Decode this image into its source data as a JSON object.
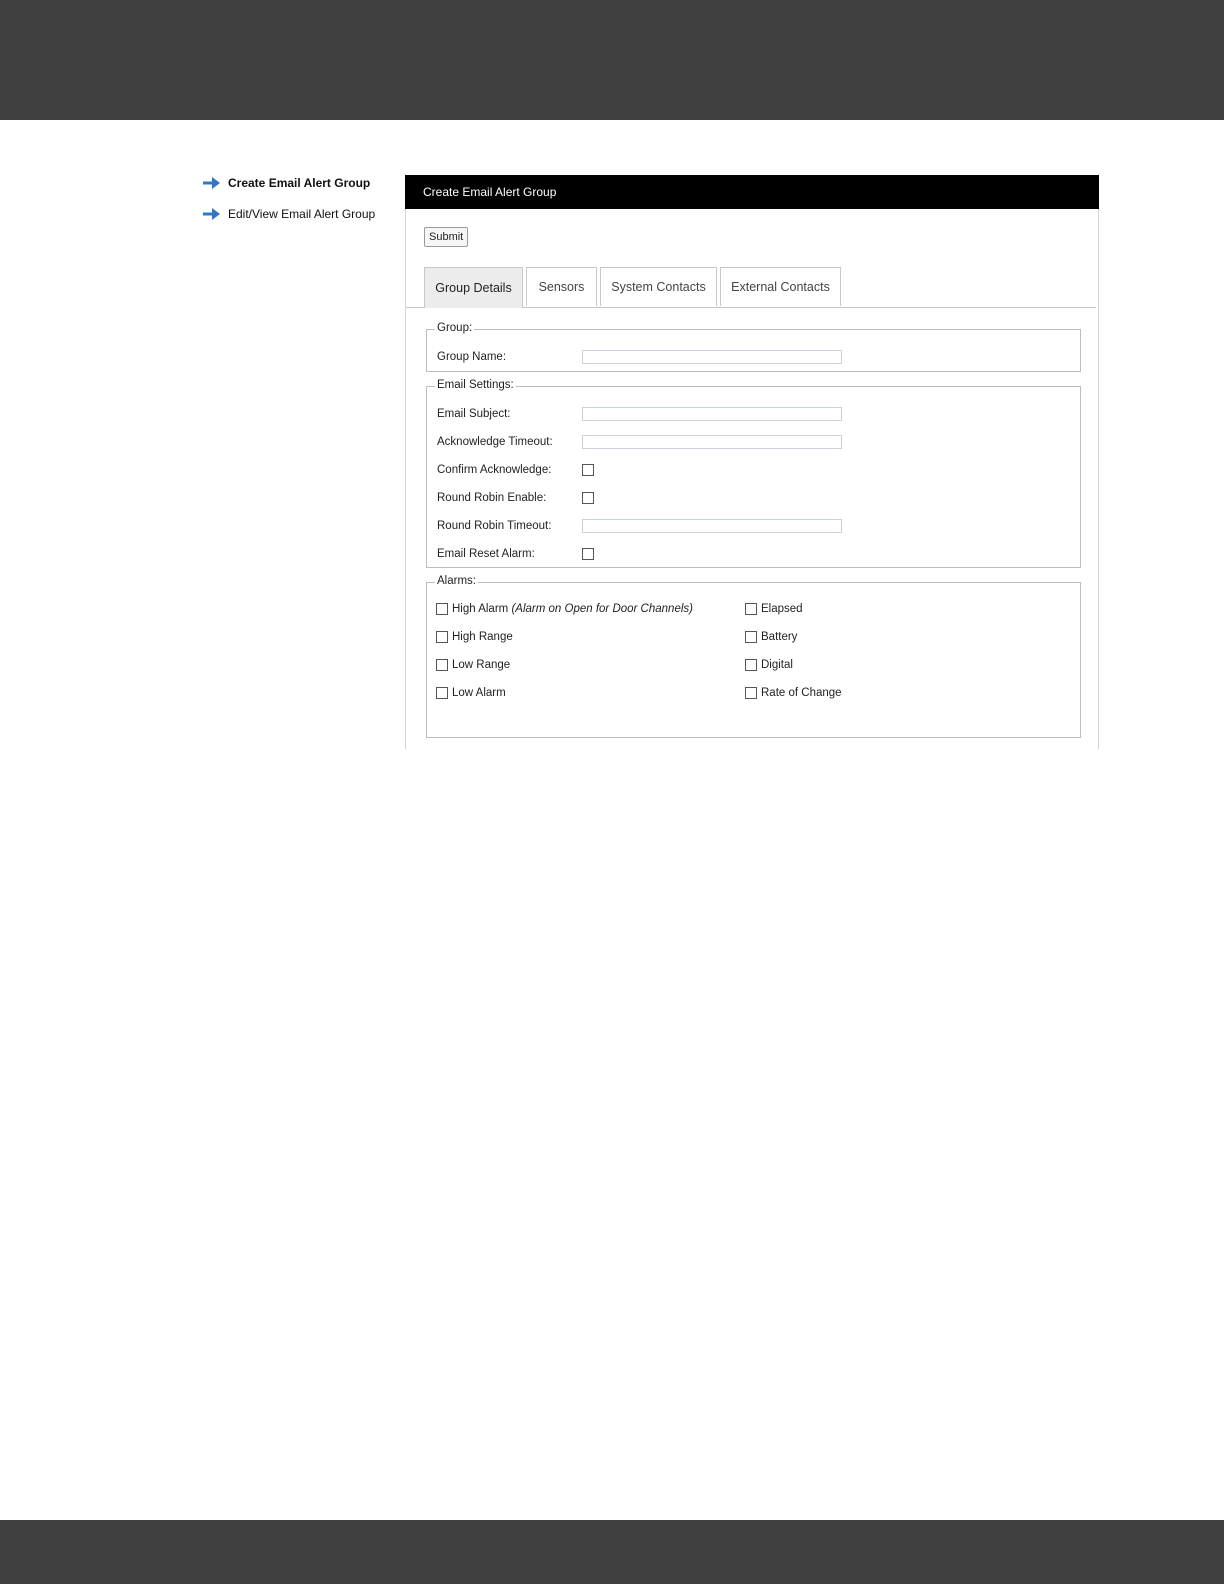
{
  "sidebar": {
    "items": [
      {
        "label": "Create Email Alert Group",
        "active": true,
        "icon": "arrow-right-icon"
      },
      {
        "label": "Edit/View Email Alert Group",
        "active": false,
        "icon": "arrow-right-icon"
      }
    ]
  },
  "panel": {
    "title": "Create Email Alert Group",
    "submit_label": "Submit",
    "tabs": [
      {
        "label": "Group Details",
        "active": true
      },
      {
        "label": "Sensors",
        "active": false
      },
      {
        "label": "System Contacts",
        "active": false
      },
      {
        "label": "External Contacts",
        "active": false
      }
    ]
  },
  "group": {
    "legend": "Group:",
    "name_label": "Group Name:",
    "name_value": ""
  },
  "email_settings": {
    "legend": "Email Settings:",
    "subject_label": "Email Subject:",
    "subject_value": "",
    "ack_timeout_label": "Acknowledge Timeout:",
    "ack_timeout_value": "",
    "confirm_ack_label": "Confirm Acknowledge:",
    "confirm_ack_checked": false,
    "round_robin_label": "Round Robin Enable:",
    "round_robin_checked": false,
    "round_robin_timeout_label": "Round Robin Timeout:",
    "round_robin_timeout_value": "",
    "reset_alarm_label": "Email Reset Alarm:",
    "reset_alarm_checked": false
  },
  "alarms": {
    "legend": "Alarms:",
    "high_alarm": "High Alarm",
    "high_alarm_note": "(Alarm on Open for Door Channels)",
    "high_range": "High Range",
    "low_range": "Low Range",
    "low_alarm": "Low Alarm",
    "elapsed": "Elapsed",
    "battery": "Battery",
    "digital": "Digital",
    "rate_of_change": "Rate of Change"
  },
  "colors": {
    "band": "#404040",
    "header": "#000000",
    "arrow": "#2f78c4"
  }
}
